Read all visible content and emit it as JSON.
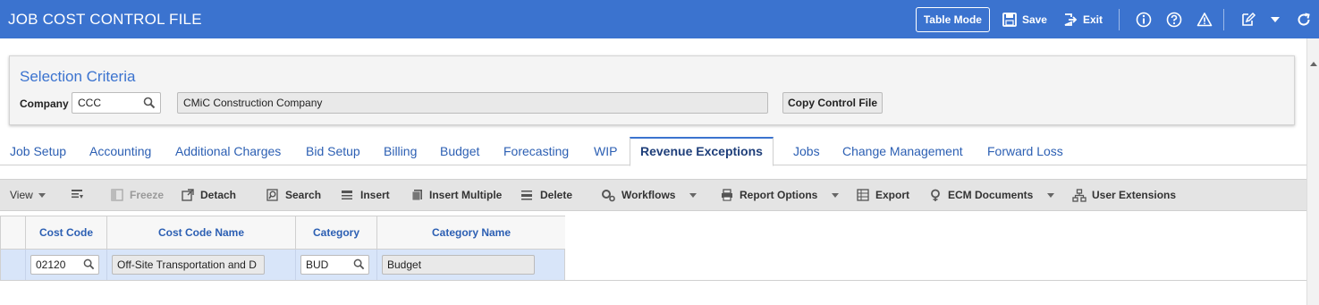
{
  "header": {
    "title": "JOB COST CONTROL FILE",
    "table_mode": "Table Mode",
    "save": "Save",
    "exit": "Exit"
  },
  "criteria": {
    "title": "Selection Criteria",
    "company_label": "Company",
    "company_value": "CCC",
    "company_name": "CMiC Construction Company",
    "copy_button": "Copy Control File"
  },
  "tabs": [
    {
      "label": "Job Setup"
    },
    {
      "label": "Accounting"
    },
    {
      "label": "Additional Charges"
    },
    {
      "label": "Bid Setup"
    },
    {
      "label": "Billing"
    },
    {
      "label": "Budget"
    },
    {
      "label": "Forecasting"
    },
    {
      "label": "WIP"
    },
    {
      "label": "Revenue Exceptions"
    },
    {
      "label": "Jobs"
    },
    {
      "label": "Change Management"
    },
    {
      "label": "Forward Loss"
    }
  ],
  "active_tab": "Revenue Exceptions",
  "toolbar": {
    "view": "View",
    "freeze": "Freeze",
    "detach": "Detach",
    "search": "Search",
    "insert": "Insert",
    "insert_multiple": "Insert Multiple",
    "delete": "Delete",
    "workflows": "Workflows",
    "report_options": "Report Options",
    "export": "Export",
    "ecm_documents": "ECM Documents",
    "user_extensions": "User Extensions"
  },
  "grid": {
    "columns": [
      "Cost Code",
      "Cost Code Name",
      "Category",
      "Category Name"
    ],
    "rows": [
      {
        "cost_code": "02120",
        "cost_code_name": "Off-Site Transportation and D",
        "category": "BUD",
        "category_name": "Budget"
      }
    ]
  },
  "colors": {
    "accent": "#3b73cf",
    "selected_row": "#d8e5f9",
    "toolbar_bg": "#e4e4e4"
  }
}
